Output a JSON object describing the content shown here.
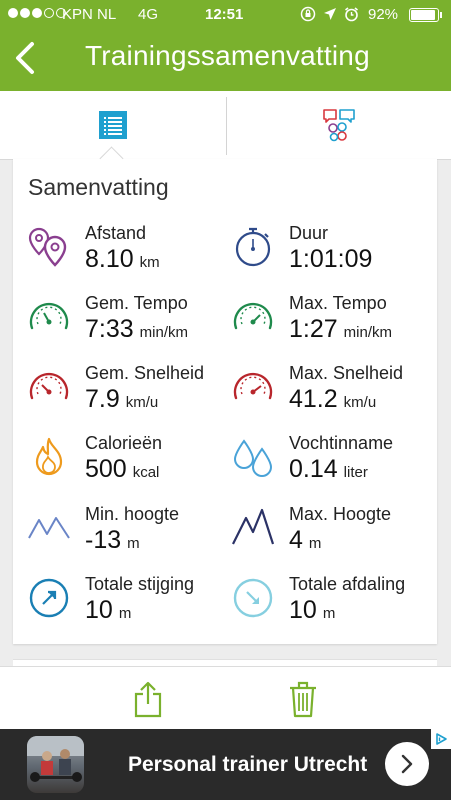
{
  "status_bar": {
    "carrier": "KPN NL",
    "network": "4G",
    "time": "12:51",
    "battery_percent": "92%",
    "battery_level": 0.92,
    "signal_bars": 3
  },
  "header": {
    "title": "Trainingssamenvatting",
    "back_icon": "chevron-left-icon"
  },
  "tabs": [
    {
      "name": "summary",
      "icon": "list-icon",
      "active": true
    },
    {
      "name": "comments",
      "icon": "chat-bubbles-icon",
      "active": false
    }
  ],
  "summary": {
    "title": "Samenvatting",
    "stats": [
      {
        "label": "Afstand",
        "value": "8.10",
        "unit": "km",
        "icon": "map-pin-icon"
      },
      {
        "label": "Duur",
        "value": "1:01:09",
        "unit": "",
        "icon": "stopwatch-icon"
      },
      {
        "label": "Gem. Tempo",
        "value": "7:33",
        "unit": "min/km",
        "icon": "gauge-green-icon"
      },
      {
        "label": "Max. Tempo",
        "value": "1:27",
        "unit": "min/km",
        "icon": "gauge-green-icon"
      },
      {
        "label": "Gem. Snelheid",
        "value": "7.9",
        "unit": "km/u",
        "icon": "gauge-red-icon"
      },
      {
        "label": "Max. Snelheid",
        "value": "41.2",
        "unit": "km/u",
        "icon": "gauge-red-icon"
      },
      {
        "label": "Calorieën",
        "value": "500",
        "unit": "kcal",
        "icon": "flame-icon"
      },
      {
        "label": "Vochtinname",
        "value": "0.14",
        "unit": "liter",
        "icon": "water-drops-icon"
      },
      {
        "label": "Min. hoogte",
        "value": "-13",
        "unit": "m",
        "icon": "mountain-light-icon"
      },
      {
        "label": "Max. Hoogte",
        "value": "4",
        "unit": "m",
        "icon": "mountain-dark-icon"
      },
      {
        "label": "Totale stijging",
        "value": "10",
        "unit": "m",
        "icon": "arrow-up-circle-icon"
      },
      {
        "label": "Totale afdaling",
        "value": "10",
        "unit": "m",
        "icon": "arrow-down-circle-icon"
      }
    ]
  },
  "toolbar": {
    "share_icon": "share-icon",
    "delete_icon": "trash-icon"
  },
  "ad": {
    "text": "Personal trainer Utrecht",
    "cta_icon": "chevron-right-icon",
    "badge_icon": "adchoices-icon"
  },
  "colors": {
    "header_green": "#7ab12d",
    "tab_blue": "#1fa0cf",
    "pin_purple": "#8a3f8f",
    "stopwatch_navy": "#2f4b8a",
    "gauge_green": "#1f8a4c",
    "gauge_red": "#b8262c",
    "flame_orange": "#ee9a1d",
    "drop_blue": "#4aa3d8",
    "mountain_light": "#6a85c7",
    "mountain_dark": "#2b3266",
    "ascent_blue": "#1a7fb4",
    "descent_teal": "#86cfe0",
    "toolbar_green": "#7ab12d"
  }
}
